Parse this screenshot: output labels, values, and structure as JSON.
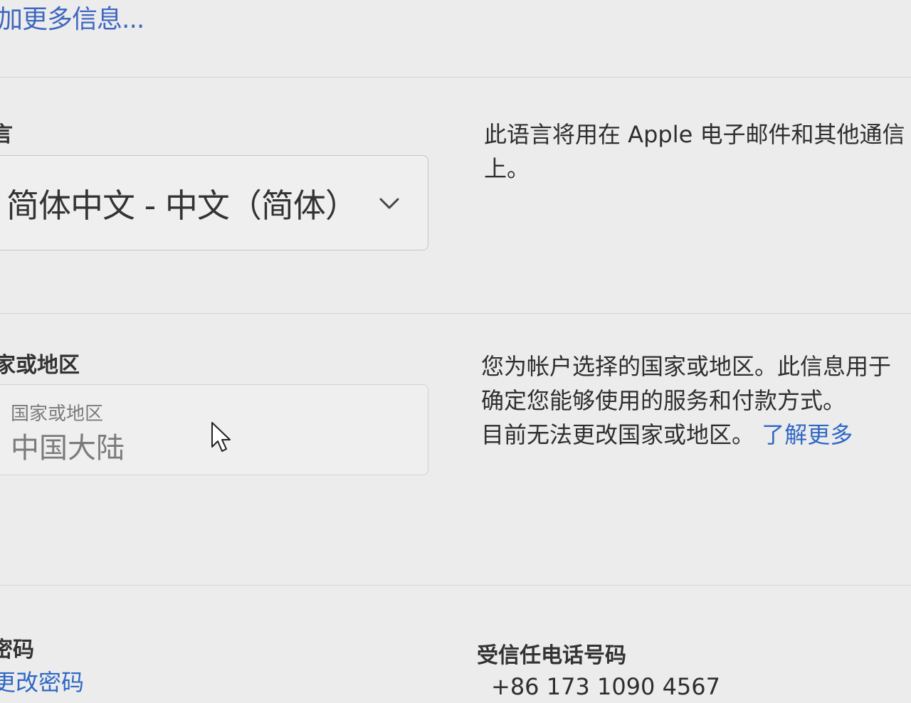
{
  "top": {
    "more_info_link": "加更多信息..."
  },
  "language": {
    "label": "言",
    "selected_value": "简体中文 - 中文（简体）",
    "description_line1": "此语言将用在 Apple 电子邮件和其他通信",
    "description_line2": "上。"
  },
  "region": {
    "label": "家或地区",
    "field_caption": "国家或地区",
    "field_value": "中国大陆",
    "description_line1": "您为帐户选择的国家或地区。此信息用于",
    "description_line2": "确定您能够使用的服务和付款方式。",
    "description_line3": "目前无法更改国家或地区。",
    "learn_more_link": "了解更多"
  },
  "password": {
    "label": "密码",
    "change_link": "更改密码"
  },
  "trusted_phone": {
    "label": "受信任电话号码",
    "value": "+86 173 1090 4567"
  },
  "colors": {
    "link": "#2f67c5",
    "background": "#ececec",
    "border": "#c6c6c6"
  }
}
